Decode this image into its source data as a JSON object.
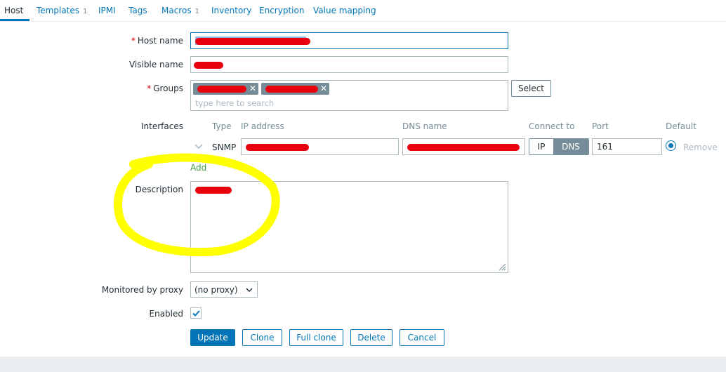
{
  "tabs": [
    {
      "label": "Host",
      "count": ""
    },
    {
      "label": "Templates",
      "count": "1"
    },
    {
      "label": "IPMI",
      "count": ""
    },
    {
      "label": "Tags",
      "count": ""
    },
    {
      "label": "Macros",
      "count": "1"
    },
    {
      "label": "Inventory",
      "count": ""
    },
    {
      "label": "Encryption",
      "count": ""
    },
    {
      "label": "Value mapping",
      "count": ""
    }
  ],
  "form": {
    "host_name_label": "Host name",
    "required_mark": "*",
    "visible_name_label": "Visible name",
    "groups_label": "Groups",
    "groups_placeholder": "type here to search",
    "select_button": "Select",
    "interfaces_label": "Interfaces",
    "interfaces": {
      "headers": {
        "type": "Type",
        "ip": "IP address",
        "dns": "DNS name",
        "connect": "Connect to",
        "port": "Port",
        "default": "Default"
      },
      "row": {
        "type": "SNMP",
        "port": "161",
        "connect_ip": "IP",
        "connect_dns": "DNS",
        "connect_selected": "DNS",
        "remove": "Remove"
      },
      "add_link": "Add"
    },
    "description_label": "Description",
    "proxy_label": "Monitored by proxy",
    "proxy_value": "(no proxy)",
    "enabled_label": "Enabled",
    "enabled": true
  },
  "actions": {
    "update": "Update",
    "clone": "Clone",
    "full_clone": "Full clone",
    "delete": "Delete",
    "cancel": "Cancel"
  },
  "colors": {
    "accent": "#0275b8",
    "redaction": "#e8000c",
    "highlight": "#ffff00",
    "border": "#acbbc2"
  }
}
